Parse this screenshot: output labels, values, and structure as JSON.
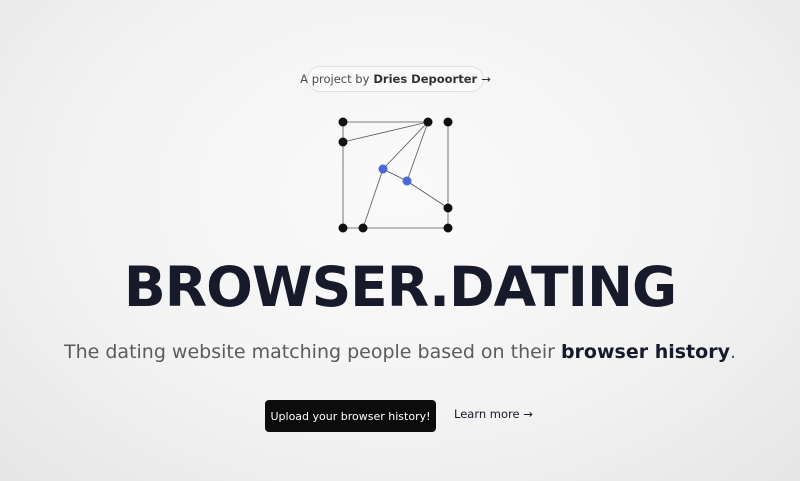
{
  "header": {
    "project_prefix": "A project by",
    "project_author": "Dries Depoorter",
    "project_arrow": "→"
  },
  "logo": {
    "icon": "network-graph-logo",
    "node_color": "#111111",
    "accent_color": "#4a68d9"
  },
  "hero": {
    "title": "BROWSER.DATING",
    "tagline_prefix": "The dating website matching people based on their",
    "tagline_emphasis": "browser history",
    "tagline_suffix": "."
  },
  "actions": {
    "upload_label": "Upload your browser history!",
    "learn_label": "Learn more",
    "learn_arrow": "→"
  }
}
